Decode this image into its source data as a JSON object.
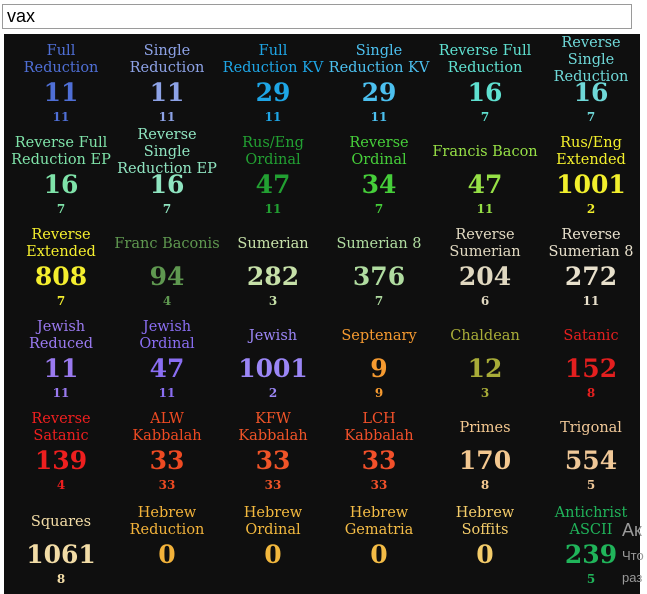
{
  "search": {
    "value": "vax",
    "placeholder": ""
  },
  "ciphers": [
    {
      "name": "Full\nReduction",
      "value": "11",
      "reduced": "11",
      "color": "#4f6fd6"
    },
    {
      "name": "Single\nReduction",
      "value": "11",
      "reduced": "11",
      "color": "#8da2e6"
    },
    {
      "name": "Full\nReduction KV",
      "value": "29",
      "reduced": "11",
      "color": "#1ea6e6"
    },
    {
      "name": "Single\nReduction KV",
      "value": "29",
      "reduced": "11",
      "color": "#4cc0ef"
    },
    {
      "name": "Reverse Full\nReduction",
      "value": "16",
      "reduced": "7",
      "color": "#5fe0d0"
    },
    {
      "name": "Reverse Single\nReduction",
      "value": "16",
      "reduced": "7",
      "color": "#6fd8d8"
    },
    {
      "name": "Reverse Full\nReduction EP",
      "value": "16",
      "reduced": "7",
      "color": "#7fe3a9"
    },
    {
      "name": "Reverse Single\nReduction EP",
      "value": "16",
      "reduced": "7",
      "color": "#8fe4c0"
    },
    {
      "name": "Rus/Eng\nOrdinal",
      "value": "47",
      "reduced": "11",
      "color": "#22a032"
    },
    {
      "name": "Reverse\nOrdinal",
      "value": "34",
      "reduced": "7",
      "color": "#46cf3a"
    },
    {
      "name": "Francis Bacon",
      "value": "47",
      "reduced": "11",
      "color": "#96e046"
    },
    {
      "name": "Rus/Eng\nExtended",
      "value": "1001",
      "reduced": "2",
      "color": "#f2ef2c"
    },
    {
      "name": "Reverse\nExtended",
      "value": "808",
      "reduced": "7",
      "color": "#f4ee2e"
    },
    {
      "name": "Franc Baconis",
      "value": "94",
      "reduced": "4",
      "color": "#5f9850"
    },
    {
      "name": "Sumerian",
      "value": "282",
      "reduced": "3",
      "color": "#c6e0a8"
    },
    {
      "name": "Sumerian 8",
      "value": "376",
      "reduced": "7",
      "color": "#b0dca0"
    },
    {
      "name": "Reverse\nSumerian",
      "value": "204",
      "reduced": "6",
      "color": "#e0d8c0"
    },
    {
      "name": "Reverse\nSumerian 8",
      "value": "272",
      "reduced": "11",
      "color": "#e8e0cc"
    },
    {
      "name": "Jewish\nReduced",
      "value": "11",
      "reduced": "11",
      "color": "#9a7af0"
    },
    {
      "name": "Jewish\nOrdinal",
      "value": "47",
      "reduced": "11",
      "color": "#8a6ef2"
    },
    {
      "name": "Jewish",
      "value": "1001",
      "reduced": "2",
      "color": "#9b86f6"
    },
    {
      "name": "Septenary",
      "value": "9",
      "reduced": "9",
      "color": "#f59a30"
    },
    {
      "name": "Chaldean",
      "value": "12",
      "reduced": "3",
      "color": "#a8ac38"
    },
    {
      "name": "Satanic",
      "value": "152",
      "reduced": "8",
      "color": "#e41f1f"
    },
    {
      "name": "Reverse\nSatanic",
      "value": "139",
      "reduced": "4",
      "color": "#ee1f1f"
    },
    {
      "name": "ALW\nKabbalah",
      "value": "33",
      "reduced": "33",
      "color": "#ee4a22"
    },
    {
      "name": "KFW\nKabbalah",
      "value": "33",
      "reduced": "33",
      "color": "#f05428"
    },
    {
      "name": "LCH\nKabbalah",
      "value": "33",
      "reduced": "33",
      "color": "#f2502a"
    },
    {
      "name": "Primes",
      "value": "170",
      "reduced": "8",
      "color": "#f4c890"
    },
    {
      "name": "Trigonal",
      "value": "554",
      "reduced": "5",
      "color": "#f0c898"
    },
    {
      "name": "Squares",
      "value": "1061",
      "reduced": "8",
      "color": "#f2dca6"
    },
    {
      "name": "Hebrew\nReduction",
      "value": "0",
      "reduced": "",
      "color": "#f2b23a"
    },
    {
      "name": "Hebrew\nOrdinal",
      "value": "0",
      "reduced": "",
      "color": "#f2b83e"
    },
    {
      "name": "Hebrew\nGematria",
      "value": "0",
      "reduced": "",
      "color": "#f4bc46"
    },
    {
      "name": "Hebrew Soffits",
      "value": "0",
      "reduced": "",
      "color": "#f4cc6a"
    },
    {
      "name": "Antichrist\nASCII",
      "value": "239",
      "reduced": "5",
      "color": "#20b45a"
    }
  ],
  "overlay": {
    "line1": "Ак",
    "line2": "Что",
    "line3": "раз"
  }
}
